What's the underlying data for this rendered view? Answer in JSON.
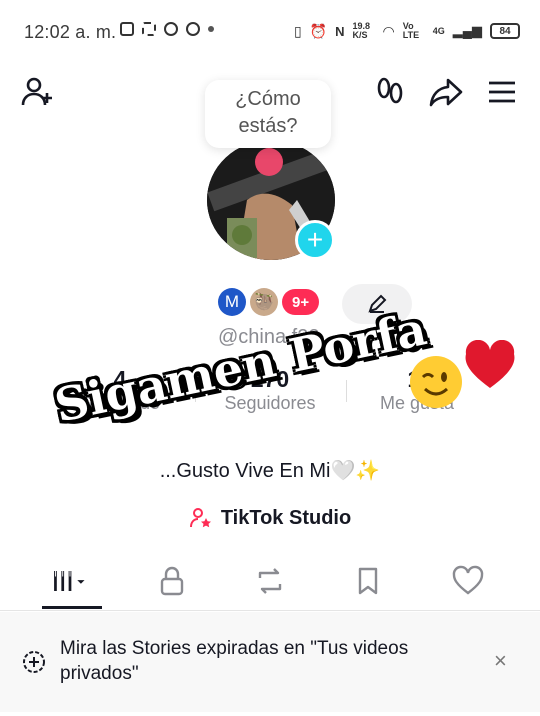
{
  "status_bar": {
    "time": "12:02 a. m.",
    "net_speed": "19.8 K/S",
    "network": "Vo LTE",
    "signal": "4G",
    "battery": "84"
  },
  "header": {
    "icons": [
      "add-user-icon",
      "footprint-icon",
      "share-icon",
      "menu-icon"
    ]
  },
  "note": {
    "text_line1": "¿Cómo",
    "text_line2": "estás?"
  },
  "profile": {
    "badge_letter": "M",
    "badge_count": "9+",
    "username": "@china.f22",
    "avatar_add": "+"
  },
  "stats": [
    {
      "value": "4",
      "label": "Siguiendo"
    },
    {
      "value": "270",
      "label": "Seguidores"
    },
    {
      "value": "1,",
      "label": "Me gusta"
    }
  ],
  "bio": "...Gusto Vive En Mi🤍✨",
  "studio_label": "TikTok Studio",
  "tabs": [
    "grid-icon",
    "lock-icon",
    "repost-icon",
    "bookmark-icon",
    "heart-icon"
  ],
  "banner": {
    "text": "Mira las Stories expiradas en \"Tus videos privados\"",
    "close": "×"
  },
  "overlay": {
    "text": "Sigamen Porfa"
  },
  "colors": {
    "accent": "#fe2c55",
    "cyan": "#20d5ec",
    "badge_blue": "#1f57c8"
  }
}
